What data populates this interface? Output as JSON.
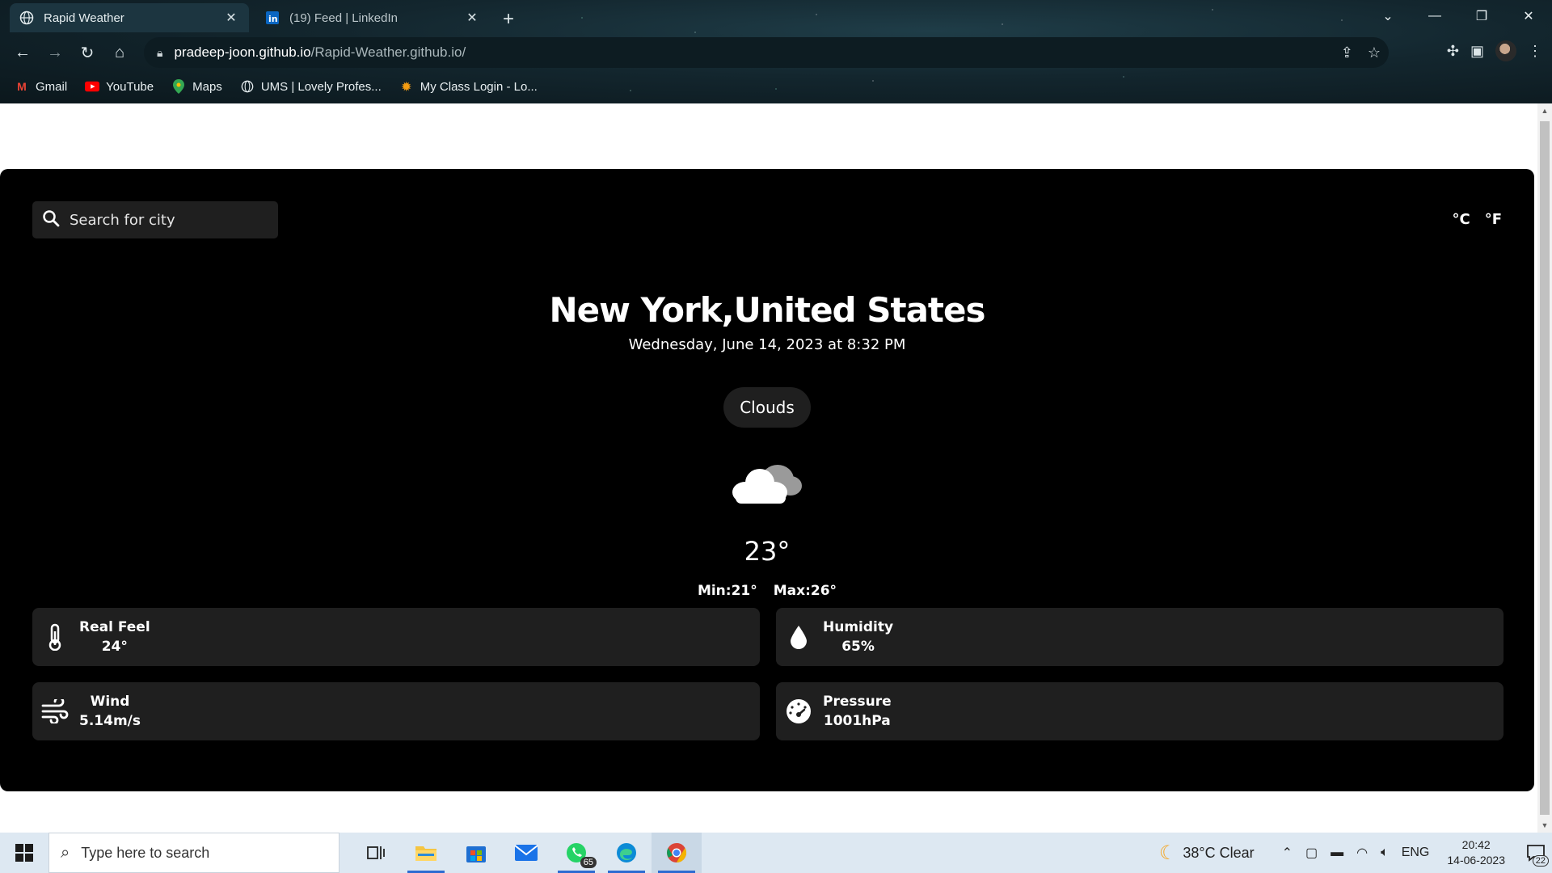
{
  "browser": {
    "tabs": [
      {
        "title": "Rapid Weather",
        "active": true
      },
      {
        "title": "(19) Feed | LinkedIn",
        "active": false
      }
    ],
    "url_host": "pradeep-joon.github.io",
    "url_path": "/Rapid-Weather.github.io/",
    "bookmarks": [
      {
        "label": "Gmail",
        "icon": "gmail-icon"
      },
      {
        "label": "YouTube",
        "icon": "youtube-icon"
      },
      {
        "label": "Maps",
        "icon": "maps-icon"
      },
      {
        "label": "UMS | Lovely Profes...",
        "icon": "globe-icon"
      },
      {
        "label": "My Class Login - Lo...",
        "icon": "sun-icon"
      }
    ]
  },
  "app": {
    "search_placeholder": "Search for city",
    "unit_c": "°C",
    "unit_f": "°F",
    "city": "New York,United States",
    "datetime": "Wednesday, June 14, 2023 at 8:32 PM",
    "condition": "Clouds",
    "temperature": "23°",
    "min": "Min:21°",
    "max": "Max:26°",
    "details": [
      {
        "label": "Real Feel",
        "value": "24°",
        "icon": "thermometer-icon"
      },
      {
        "label": "Humidity",
        "value": "65%",
        "icon": "droplet-icon"
      },
      {
        "label": "Wind",
        "value": "5.14m/s",
        "icon": "wind-icon"
      },
      {
        "label": "Pressure",
        "value": "1001hPa",
        "icon": "gauge-icon"
      }
    ]
  },
  "taskbar": {
    "search_placeholder": "Type here to search",
    "whatsapp_badge": "65",
    "weather": "38°C Clear",
    "language": "ENG",
    "time": "20:42",
    "date": "14-06-2023",
    "notifications": "22"
  }
}
